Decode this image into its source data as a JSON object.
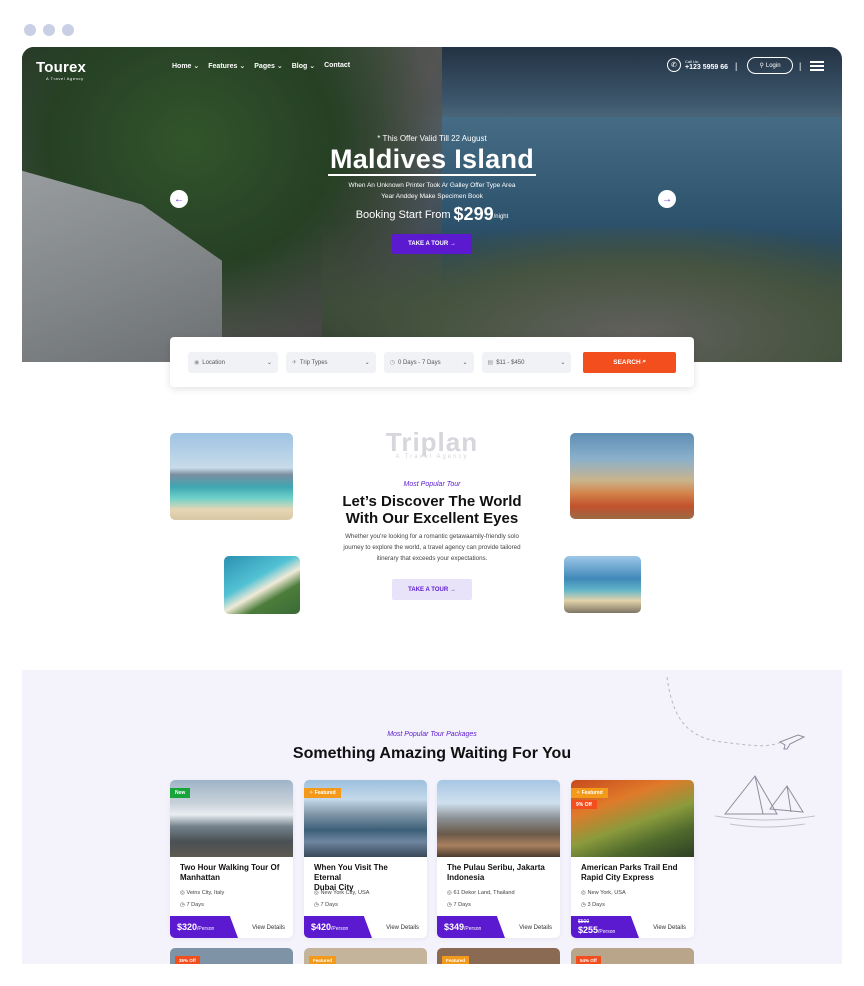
{
  "brand": {
    "name": "Tourex",
    "tagline": "A Travel Agency"
  },
  "nav": {
    "items": [
      "Home ⌄",
      "Features ⌄",
      "Pages ⌄",
      "Blog ⌄",
      "Contact"
    ]
  },
  "call": {
    "label": "Call Us:",
    "number": "+123 5959 66"
  },
  "login_label": "Login",
  "hero": {
    "offer": "* This Offer Valid Till 22 August",
    "title": "Maldives Island",
    "sub1": "When An Unknown Printer Took Ar Galley Offer Type Area",
    "sub2": "Year Anddey Make Specimen Book",
    "price_prefix": "Booking Start From",
    "price": "$299",
    "price_suffix": "/night",
    "cta": "TAKE A TOUR →",
    "prev_icon": "←",
    "next_icon": "→"
  },
  "search": {
    "location": "Location",
    "trip_types": "Trip Types",
    "days": "0 Days - 7 Days",
    "price_range": "$11 - $450",
    "button": "SEARCH"
  },
  "about": {
    "watermark": "Triplan",
    "watermark_sub": "A Travel Agency",
    "kicker": "Most Popular Tour",
    "heading1": "Let’s Discover The World",
    "heading2": "With Our Excellent Eyes",
    "p1": "Whether you're looking for a romantic getawaamily-friendly solo",
    "p2": "journey to explore the world, a travel agency can provide tailored",
    "p3": "itinerary that exceeds your expectations.",
    "cta": "TAKE A TOUR →"
  },
  "packages": {
    "kicker": "Most Popular Tour Packages",
    "heading": "Something Amazing Waiting For You",
    "cards": [
      {
        "badge": "New",
        "badge_color": "#18a33b",
        "discount": "",
        "title1": "Two Hour Walking Tour Of",
        "title2": "Manhattan",
        "location": "Veins City, Italy",
        "duration": "7 Days",
        "old_price": "",
        "price": "$320",
        "unit": "/Person",
        "link": "View Details"
      },
      {
        "badge": "Featured",
        "badge_color": "#f49a1a",
        "discount": "",
        "title1": "When You Visit The Eternal",
        "title2": "Dubai City",
        "location": "New York City, USA",
        "duration": "7 Days",
        "old_price": "",
        "price": "$420",
        "unit": "/Person",
        "link": "View Details"
      },
      {
        "badge": "",
        "badge_color": "",
        "discount": "",
        "title1": "The Pulau Seribu, Jakarta",
        "title2": "Indonesia",
        "location": "61 Dekor Land, Thailand",
        "duration": "7 Days",
        "old_price": "",
        "price": "$349",
        "unit": "/Person",
        "link": "View Details"
      },
      {
        "badge": "Featured",
        "badge_color": "#f49a1a",
        "discount": "9% Off",
        "title1": "American Parks Trail End",
        "title2": "Rapid City Express",
        "location": "New York, USA",
        "duration": "3 Days",
        "old_price": "$500",
        "price": "$255",
        "unit": "/Person",
        "link": "View Details"
      }
    ],
    "next_row_badges": [
      "35% Off",
      "Featured",
      "Featured",
      "54% Off"
    ]
  }
}
